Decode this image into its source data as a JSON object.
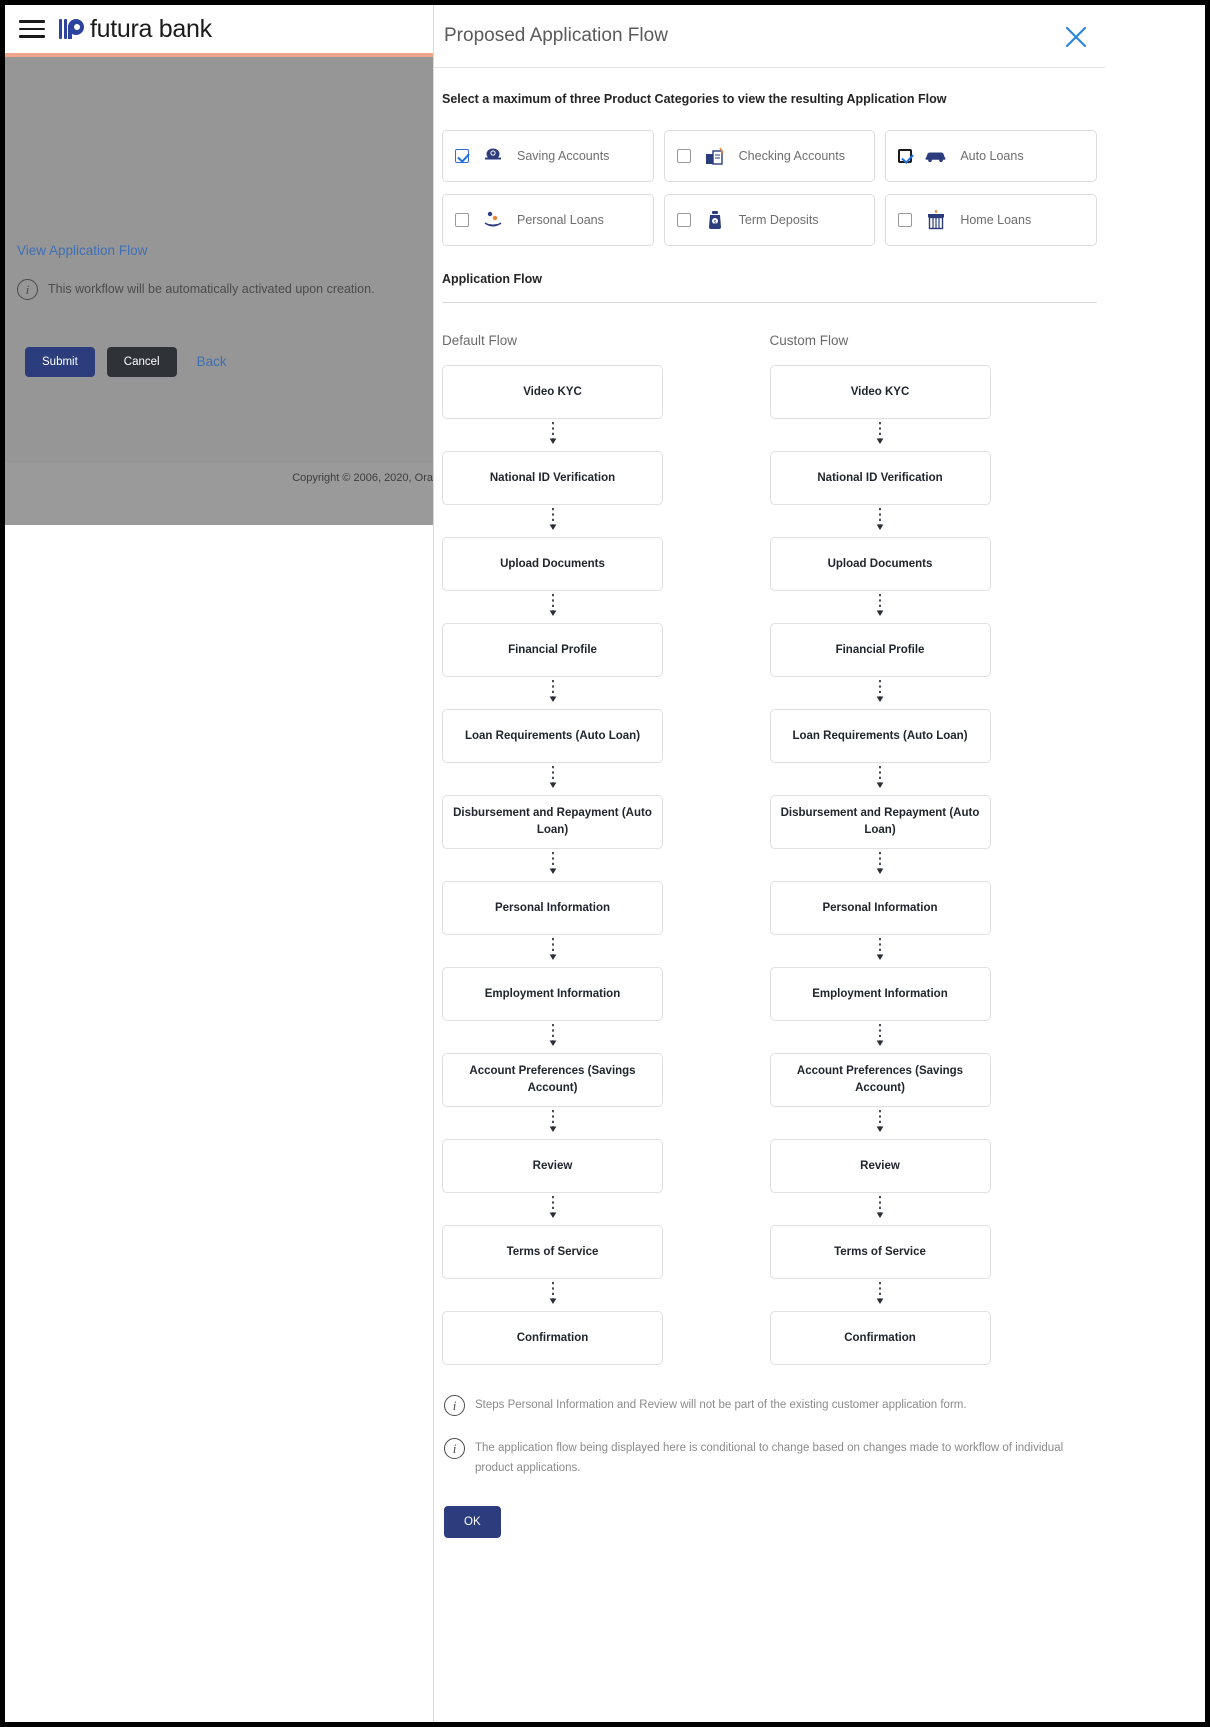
{
  "background_app": {
    "brand_name": "futura bank",
    "menu_icon": "hamburger-icon",
    "view_application_flow_link": "View Application Flow",
    "workflow_note": "This workflow will be automatically activated upon creation.",
    "buttons": {
      "submit": "Submit",
      "cancel": "Cancel",
      "back": "Back"
    },
    "copyright": "Copyright © 2006, 2020, Ora"
  },
  "overlay": {
    "title": "Proposed Application Flow",
    "close_icon": "close-icon",
    "close_color": "#2f86d6",
    "instruction": "Select a maximum of three Product Categories to view the resulting Application Flow",
    "product_categories": [
      {
        "label": "Saving Accounts",
        "checked": true,
        "icon": "piggy-bank-icon"
      },
      {
        "label": "Checking Accounts",
        "checked": false,
        "icon": "checkbook-icon"
      },
      {
        "label": "Auto Loans",
        "checked": true,
        "icon": "car-icon"
      },
      {
        "label": "Personal Loans",
        "checked": false,
        "icon": "hand-coins-icon"
      },
      {
        "label": "Term Deposits",
        "checked": false,
        "icon": "deposit-jar-icon"
      },
      {
        "label": "Home Loans",
        "checked": false,
        "icon": "house-icon"
      }
    ],
    "flow_section_heading": "Application Flow",
    "flows": [
      {
        "title": "Default Flow",
        "steps": [
          "Video KYC",
          "National ID Verification",
          "Upload Documents",
          "Financial Profile",
          "Loan Requirements (Auto Loan)",
          "Disbursement and Repayment (Auto Loan)",
          "Personal Information",
          "Employment Information",
          "Account Preferences (Savings Account)",
          "Review",
          "Terms of Service",
          "Confirmation"
        ]
      },
      {
        "title": "Custom Flow",
        "steps": [
          "Video KYC",
          "National ID Verification",
          "Upload Documents",
          "Financial Profile",
          "Loan Requirements (Auto Loan)",
          "Disbursement and Repayment (Auto Loan)",
          "Personal Information",
          "Employment Information",
          "Account Preferences (Savings Account)",
          "Review",
          "Terms of Service",
          "Confirmation"
        ]
      }
    ],
    "notes": [
      "Steps Personal Information and Review will not be part of the existing customer application form.",
      "The application flow being displayed here is conditional to change based on changes made to workflow of individual product applications."
    ],
    "ok_label": "OK"
  },
  "colors": {
    "primary_button": "#2b3d7d",
    "link": "#3f6fb5",
    "accent_bar": "#f0a68d",
    "checkbox_checked": "#1f6fe0"
  }
}
